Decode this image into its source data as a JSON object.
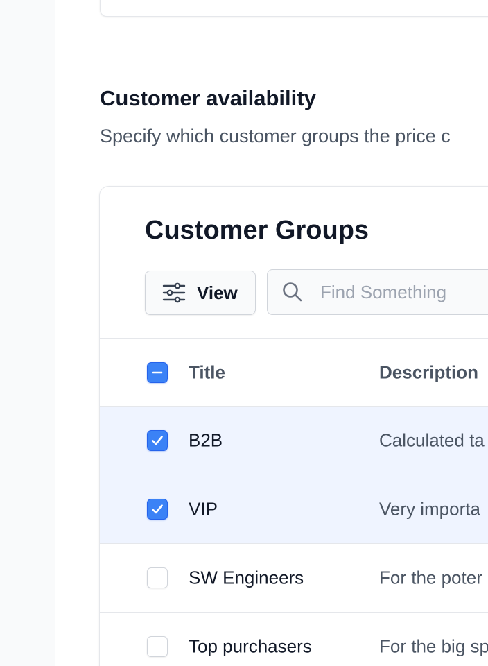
{
  "section": {
    "title": "Customer availability",
    "description": "Specify which customer groups the price c"
  },
  "card": {
    "title": "Customer Groups",
    "view_button": {
      "label": "View",
      "icon": "sliders-icon"
    },
    "search": {
      "placeholder": "Find Something",
      "value": "",
      "icon": "search-icon"
    }
  },
  "table": {
    "columns": {
      "title": "Title",
      "description": "Description"
    },
    "header_checkbox_state": "indeterminate",
    "rows": [
      {
        "title": "B2B",
        "description": "Calculated ta",
        "selected": true
      },
      {
        "title": "VIP",
        "description": "Very importa",
        "selected": true
      },
      {
        "title": "SW Engineers",
        "description": "For the poter",
        "selected": false
      },
      {
        "title": "Top purchasers",
        "description": "For the big sp",
        "selected": false
      }
    ]
  },
  "colors": {
    "accent": "#3b82f6",
    "selected_row_bg": "#eff4ff",
    "rail_bg": "#f9fafb"
  }
}
